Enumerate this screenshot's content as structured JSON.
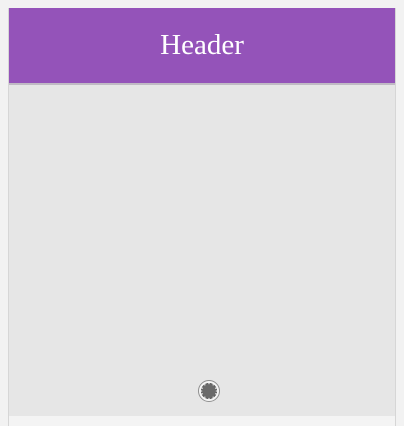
{
  "header": {
    "title": "Header"
  },
  "colors": {
    "header_background": "#9453b9",
    "header_text": "#ffffff",
    "content_background": "#e6e6e6",
    "page_background": "#f2f2f2"
  },
  "content": {
    "loading_indicator_icon": "loading-spinner-icon"
  }
}
